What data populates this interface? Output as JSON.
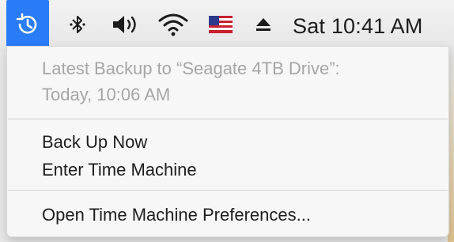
{
  "menubar": {
    "clock": "Sat 10:41 AM",
    "icons": [
      "time-machine-icon",
      "bluetooth-icon",
      "volume-icon",
      "wifi-icon",
      "us-flag-icon",
      "eject-icon"
    ]
  },
  "menu": {
    "status_line1": "Latest Backup to “Seagate 4TB Drive”:",
    "status_line2": "Today, 10:06 AM",
    "back_up_now": "Back Up Now",
    "enter_time_machine": "Enter Time Machine",
    "open_preferences": "Open Time Machine Preferences..."
  },
  "colors": {
    "menubar_highlight": "#2a7bf6",
    "disabled_text": "#a6a6a6"
  }
}
